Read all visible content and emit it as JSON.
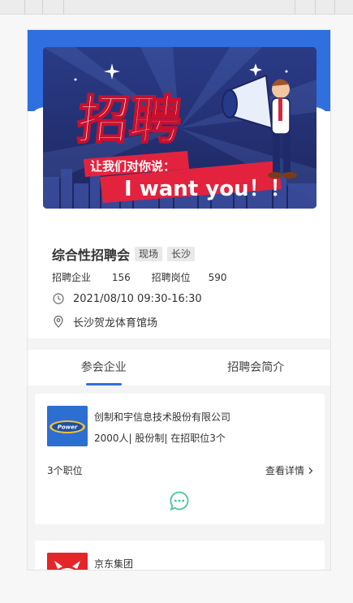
{
  "banner": {
    "headline": "招聘",
    "subtitle": "让我们对你说：",
    "slogan": "I want you！！"
  },
  "fair": {
    "title": "综合性招聘会",
    "tags": [
      "现场",
      "长沙"
    ],
    "companies_label": "招聘企业",
    "companies_count": "156",
    "positions_label": "招聘岗位",
    "positions_count": "590",
    "datetime": "2021/08/10 09:30-16:30",
    "location": "长沙贺龙体育馆场"
  },
  "tabs": [
    {
      "label": "参会企业",
      "active": true
    },
    {
      "label": "招聘会简介",
      "active": false
    }
  ],
  "companies": [
    {
      "name": "创制和宇信息技术股份有限公司",
      "meta": "2000人| 股份制| 在招职位3个",
      "jobs": "3个职位",
      "detail_label": "查看详情",
      "logo_text": "Power",
      "logo_color": "#2c6fd1"
    },
    {
      "name": "京东集团",
      "logo_color": "#e4262b"
    }
  ],
  "colors": {
    "accent": "#2f6fe0",
    "chat_icon": "#48c79c"
  }
}
